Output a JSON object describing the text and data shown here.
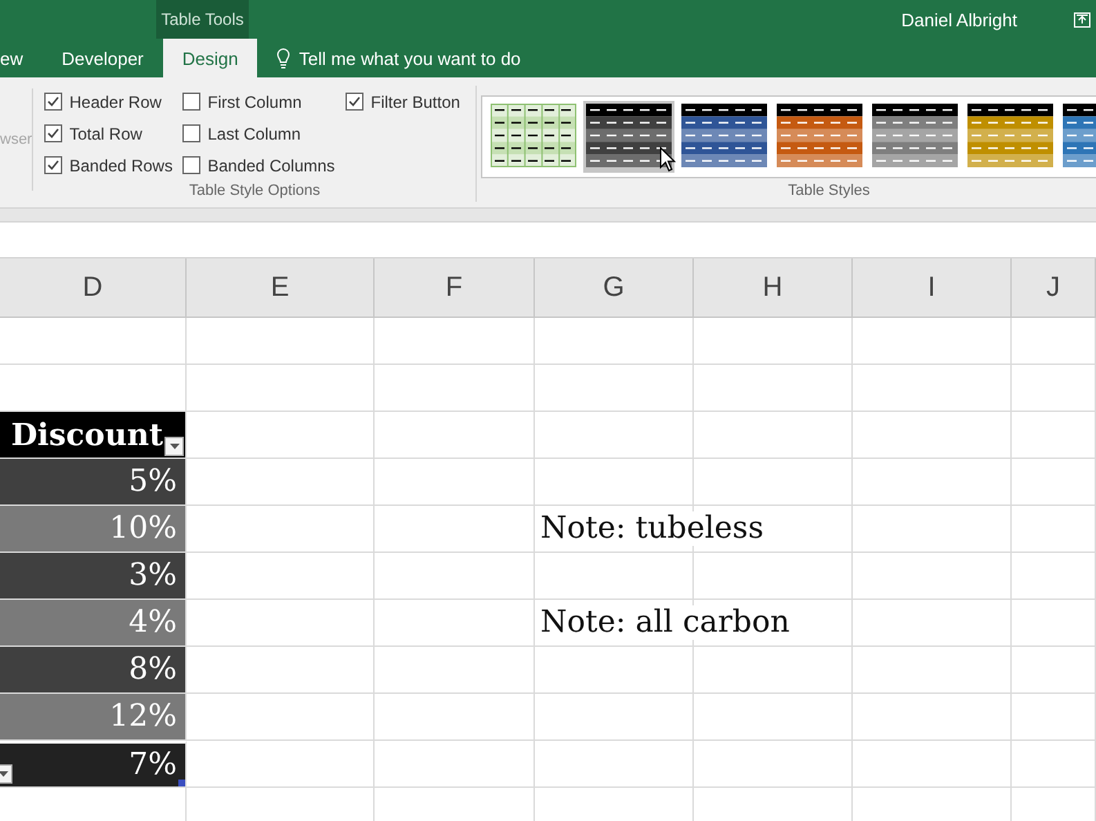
{
  "title_bar": {
    "context_label": "Table Tools",
    "user": "Daniel Albright"
  },
  "ribbon_tabs": [
    {
      "label": "ew",
      "selected": false
    },
    {
      "label": "Developer",
      "selected": false
    },
    {
      "label": "Design",
      "selected": true
    }
  ],
  "tell_me": {
    "placeholder": "Tell me what you want to do"
  },
  "ribbon": {
    "left_cut_label": {
      "label": "wser",
      "disabled": true
    },
    "style_options": {
      "title": "Table Style Options",
      "options": [
        {
          "label": "Header Row",
          "checked": true
        },
        {
          "label": "Total Row",
          "checked": true
        },
        {
          "label": "Banded Rows",
          "checked": true
        },
        {
          "label": "First Column",
          "checked": false
        },
        {
          "label": "Last Column",
          "checked": false
        },
        {
          "label": "Banded Columns",
          "checked": false
        },
        {
          "label": "Filter Button",
          "checked": true
        }
      ]
    },
    "table_styles": {
      "title": "Table Styles",
      "styles": [
        {
          "kind": "light",
          "color": "#c6e0b4",
          "selected": false
        },
        {
          "kind": "medium",
          "color": "#404040",
          "selected": true
        },
        {
          "kind": "medium",
          "color": "#2f5597",
          "selected": false
        },
        {
          "kind": "medium",
          "color": "#c55a11",
          "selected": false
        },
        {
          "kind": "medium",
          "color": "#7f7f7f",
          "selected": false
        },
        {
          "kind": "medium",
          "color": "#bf8f00",
          "selected": false
        },
        {
          "kind": "medium",
          "color": "#2e75b6",
          "selected": false
        }
      ]
    }
  },
  "sheet": {
    "columns": [
      "D",
      "E",
      "F",
      "G",
      "H",
      "I",
      "J"
    ],
    "rows": [
      {
        "kind": "blank"
      },
      {
        "kind": "blank"
      },
      {
        "kind": "header",
        "discount": "Discount"
      },
      {
        "kind": "data",
        "discount": "5%"
      },
      {
        "kind": "data",
        "discount": "10%",
        "note": "Note: tubeless"
      },
      {
        "kind": "data",
        "discount": "3%"
      },
      {
        "kind": "data",
        "discount": "4%",
        "note": "Note: all carbon"
      },
      {
        "kind": "data",
        "discount": "8%"
      },
      {
        "kind": "data",
        "discount": "12%"
      },
      {
        "kind": "total",
        "discount": "7%"
      },
      {
        "kind": "blank"
      }
    ]
  }
}
